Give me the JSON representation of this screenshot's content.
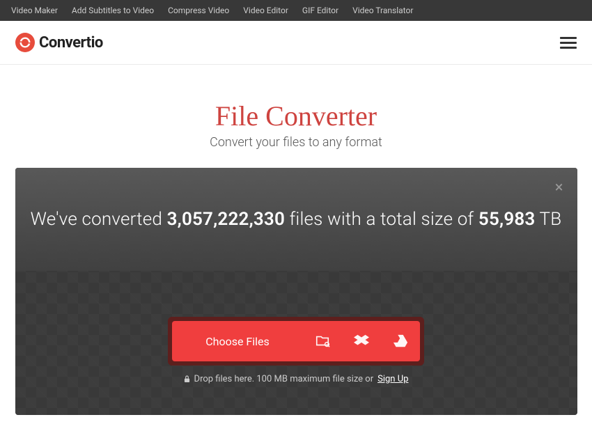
{
  "top_nav": {
    "items": [
      "Video Maker",
      "Add Subtitles to Video",
      "Compress Video",
      "Video Editor",
      "GIF Editor",
      "Video Translator"
    ]
  },
  "logo_text": "Convertio",
  "hero": {
    "title": "File Converter",
    "subtitle": "Convert your files to any format"
  },
  "stats": {
    "pre": "We've converted ",
    "files_count": "3,057,222,330",
    "mid": " files with a total size of ",
    "size_value": "55,983",
    "size_unit": " TB"
  },
  "upload": {
    "choose_label": "Choose Files",
    "hint_pre": "Drop files here. 100 MB maximum file size or ",
    "signup_label": "Sign Up"
  }
}
